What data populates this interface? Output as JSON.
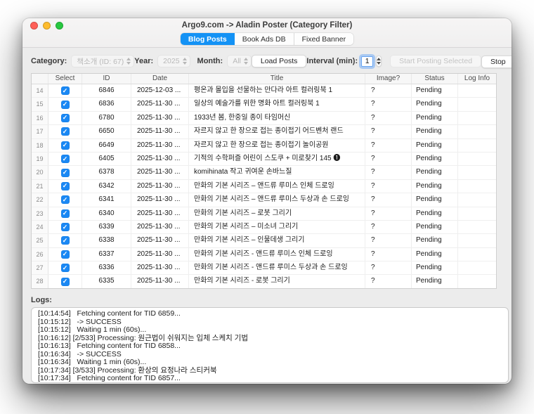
{
  "window": {
    "title": "Argo9.com -> Aladin Poster (Category Filter)"
  },
  "tabs": [
    {
      "label": "Blog Posts",
      "active": true
    },
    {
      "label": "Book Ads DB",
      "active": false
    },
    {
      "label": "Fixed Banner",
      "active": false
    }
  ],
  "controls": {
    "category_label": "Category:",
    "category_value": "책소개 (ID: 67)",
    "year_label": "Year:",
    "year_value": "2025",
    "month_label": "Month:",
    "month_value": "All",
    "load_posts_label": "Load Posts",
    "interval_label": "Interval (min):",
    "interval_value": "1",
    "start_posting_label": "Start Posting Selected",
    "stop_label": "Stop"
  },
  "table": {
    "headers": [
      "",
      "Select",
      "ID",
      "Date",
      "Title",
      "Image?",
      "Status",
      "Log Info"
    ],
    "rows": [
      {
        "num": "14",
        "selected": true,
        "id": "6846",
        "date": "2025-12-03 ...",
        "title": "평온과 몰입을 선물하는 만다라 아트 컬러링북 1",
        "image": "?",
        "status": "Pending",
        "log": ""
      },
      {
        "num": "15",
        "selected": true,
        "id": "6836",
        "date": "2025-11-30 ...",
        "title": "일상의 예술가를 위한 명화 아트 컬러링북 1",
        "image": "?",
        "status": "Pending",
        "log": ""
      },
      {
        "num": "16",
        "selected": true,
        "id": "6780",
        "date": "2025-11-30 ...",
        "title": "1933년 봄, 한중일 종이 타임머신",
        "image": "?",
        "status": "Pending",
        "log": ""
      },
      {
        "num": "17",
        "selected": true,
        "id": "6650",
        "date": "2025-11-30 ...",
        "title": "자르지 않고 한 장으로 접는 종이접기 어드벤처 랜드",
        "image": "?",
        "status": "Pending",
        "log": ""
      },
      {
        "num": "18",
        "selected": true,
        "id": "6649",
        "date": "2025-11-30 ...",
        "title": "자르지 않고 한 장으로 접는 종이접기 놀이공원",
        "image": "?",
        "status": "Pending",
        "log": ""
      },
      {
        "num": "19",
        "selected": true,
        "id": "6405",
        "date": "2025-11-30 ...",
        "title": "기적의 수학퍼즐 어린이 스도쿠 + 미로찾기 145 ❶",
        "image": "?",
        "status": "Pending",
        "log": ""
      },
      {
        "num": "20",
        "selected": true,
        "id": "6378",
        "date": "2025-11-30 ...",
        "title": "komihinata 작고 귀여운 손바느질",
        "image": "?",
        "status": "Pending",
        "log": ""
      },
      {
        "num": "21",
        "selected": true,
        "id": "6342",
        "date": "2025-11-30 ...",
        "title": "만화의 기본 시리즈 – 앤드류 루미스 인체 드로잉",
        "image": "?",
        "status": "Pending",
        "log": ""
      },
      {
        "num": "22",
        "selected": true,
        "id": "6341",
        "date": "2025-11-30 ...",
        "title": "만화의 기본 시리즈 – 앤드류 루미스 두상과 손 드로잉",
        "image": "?",
        "status": "Pending",
        "log": ""
      },
      {
        "num": "23",
        "selected": true,
        "id": "6340",
        "date": "2025-11-30 ...",
        "title": "만화의 기본 시리즈 – 로봇 그리기",
        "image": "?",
        "status": "Pending",
        "log": ""
      },
      {
        "num": "24",
        "selected": true,
        "id": "6339",
        "date": "2025-11-30 ...",
        "title": "만화의 기본 시리즈 – 미소녀 그리기",
        "image": "?",
        "status": "Pending",
        "log": ""
      },
      {
        "num": "25",
        "selected": true,
        "id": "6338",
        "date": "2025-11-30 ...",
        "title": "만화의 기본 시리즈 – 인물데생 그리기",
        "image": "?",
        "status": "Pending",
        "log": ""
      },
      {
        "num": "26",
        "selected": true,
        "id": "6337",
        "date": "2025-11-30 ...",
        "title": "만화의 기본 시리즈 - 앤드류 루미스 인체 드로잉",
        "image": "?",
        "status": "Pending",
        "log": ""
      },
      {
        "num": "27",
        "selected": true,
        "id": "6336",
        "date": "2025-11-30 ...",
        "title": "만화의 기본 시리즈 - 앤드류 루미스 두상과 손 드로잉",
        "image": "?",
        "status": "Pending",
        "log": ""
      },
      {
        "num": "28",
        "selected": true,
        "id": "6335",
        "date": "2025-11-30 ...",
        "title": "만화의 기본 시리즈 - 로봇 그리기",
        "image": "?",
        "status": "Pending",
        "log": ""
      }
    ]
  },
  "logs": {
    "label": "Logs:",
    "lines": [
      "[10:14:54]   Fetching content for TID 6859...",
      "[10:15:12]   -> SUCCESS",
      "[10:15:12]   Waiting 1 min (60s)...",
      "[10:16:12] [2/533] Processing: 원근법이 쉬워지는 입체 스케치 기법",
      "[10:16:13]   Fetching content for TID 6858...",
      "[10:16:34]   -> SUCCESS",
      "[10:16:34]   Waiting 1 min (60s)...",
      "[10:17:34] [3/533] Processing: 환상의 요정나라 스티커북",
      "[10:17:34]   Fetching content for TID 6857..."
    ]
  },
  "colors": {
    "accent_blue": "#1492f5",
    "checkbox_blue": "#1a88f4",
    "traffic_red": "#ff5f57",
    "traffic_yellow": "#febc2e",
    "traffic_green": "#28c840"
  }
}
